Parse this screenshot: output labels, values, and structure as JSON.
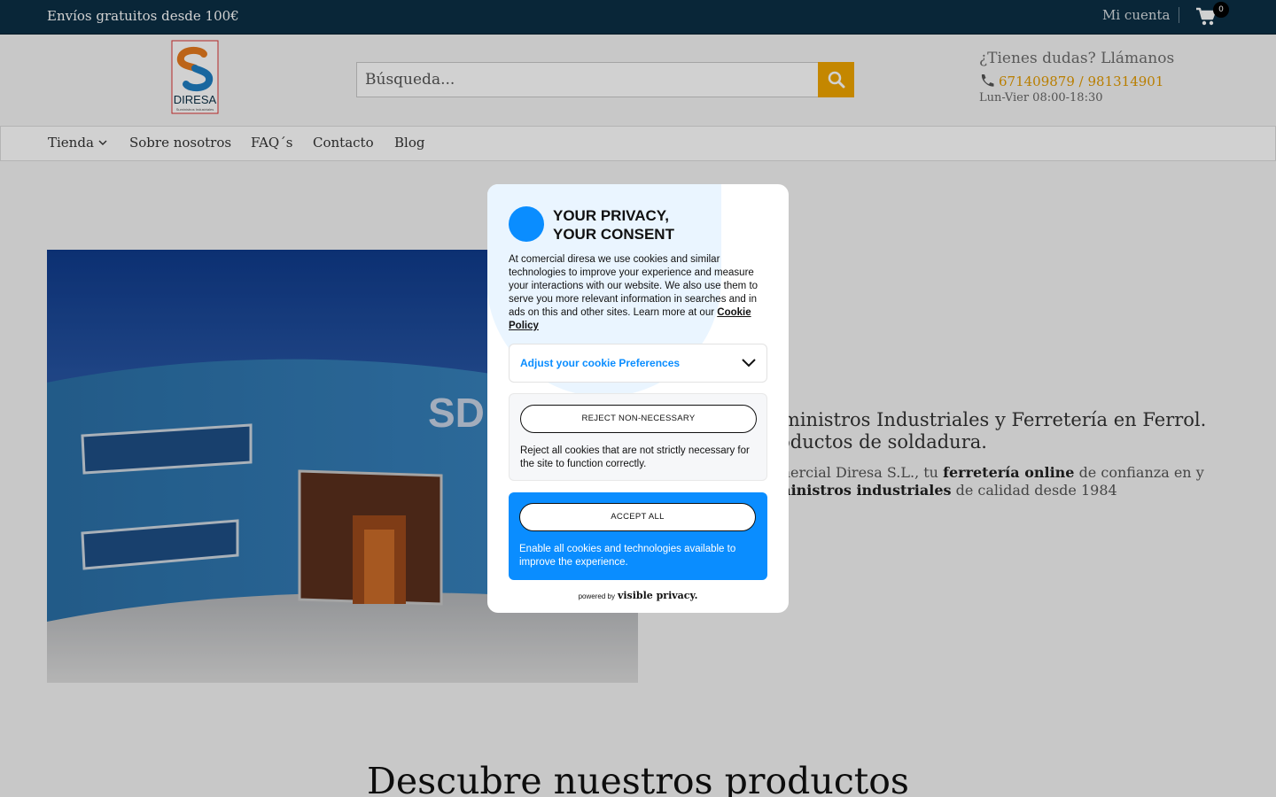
{
  "topbar": {
    "shipping_text": "Envíos gratuitos desde 100€",
    "account_label": "Mi cuenta",
    "cart_icon": "shopping-cart-icon",
    "cart_count": "0"
  },
  "header": {
    "logo_text": "DIRESA",
    "logo_subtext": "Suministros Industriales",
    "search_placeholder": "Búsqueda...",
    "search_icon": "search-icon",
    "help_title": "¿Tienes dudas? Llámanos",
    "phone_icon": "phone-icon",
    "phones": "671409879 / 981314901",
    "hours": "Lun-Vier 08:00-18:30"
  },
  "nav": {
    "items": [
      {
        "label": "Tienda"
      },
      {
        "label": "Sobre nosotros"
      },
      {
        "label": "FAQ´s"
      },
      {
        "label": "Contacto"
      },
      {
        "label": "Blog"
      }
    ]
  },
  "hero": {
    "title_line1": "Suministros Industriales y Ferretería en Ferrol.",
    "title_line2": "Productos de soldadura.",
    "sub_prefix": "Comercial Diresa S.L., tu",
    "sub_bold1": "ferretería online",
    "sub_mid": "de confianza en",
    "sub_mid2": "y",
    "sub_bold2": "suministros industriales",
    "sub_suffix": "de calidad desde 1984"
  },
  "section_title": "Descubre nuestros productos",
  "cookie_modal": {
    "title_line1": "YOUR PRIVACY,",
    "title_line2": "YOUR CONSENT",
    "description": "At comercial diresa we use cookies and similar technologies to improve your experience and measure your interactions with our website. We also use them to serve you more relevant information in searches and in ads on this and other sites. Learn more at our",
    "policy_link": "Cookie Policy",
    "adjust_label": "Adjust your cookie Preferences",
    "reject_button": "REJECT NON-NECESSARY",
    "reject_text": "Reject all cookies that are not strictly necessary for the site to function correctly.",
    "accept_button": "ACCEPT ALL",
    "accept_text": "Enable all cookies and technologies available to improve the experience.",
    "powered_by": "powered by",
    "powered_brand": "visible privacy."
  },
  "colors": {
    "topbar_bg": "#0b2f45",
    "accent": "#f0a500",
    "cookie_blue": "#0a8dff"
  }
}
